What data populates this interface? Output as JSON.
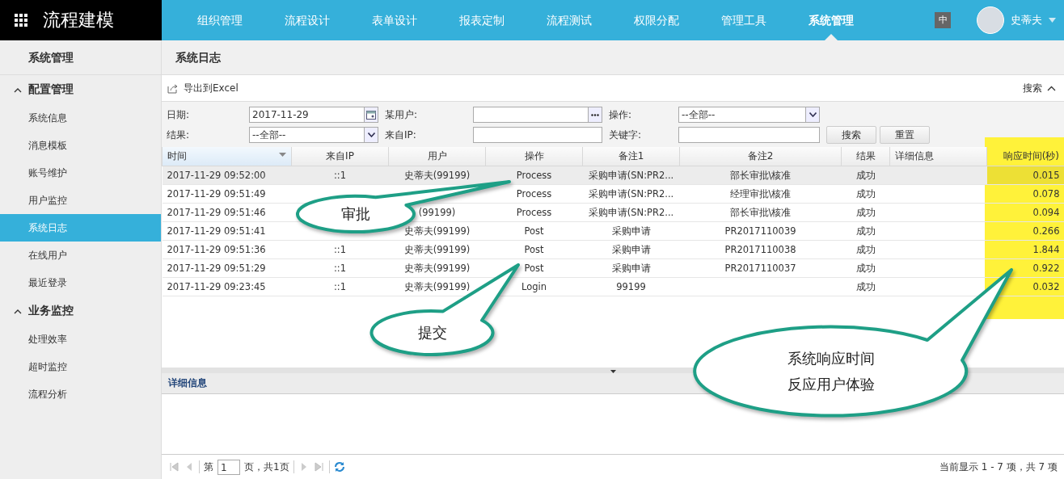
{
  "app": {
    "title": "流程建模"
  },
  "nav": [
    {
      "label": "组织管理",
      "selected": false
    },
    {
      "label": "流程设计",
      "selected": false
    },
    {
      "label": "表单设计",
      "selected": false
    },
    {
      "label": "报表定制",
      "selected": false
    },
    {
      "label": "流程测试",
      "selected": false
    },
    {
      "label": "权限分配",
      "selected": false
    },
    {
      "label": "管理工具",
      "selected": false
    },
    {
      "label": "系统管理",
      "selected": true
    }
  ],
  "language": "中",
  "user": {
    "name": "史蒂夫"
  },
  "sidebar": {
    "title": "系统管理",
    "groups": [
      {
        "label": "配置管理",
        "expanded": true,
        "children": [
          {
            "label": "系统信息",
            "selected": false
          },
          {
            "label": "消息模板",
            "selected": false
          },
          {
            "label": "账号维护",
            "selected": false
          },
          {
            "label": "用户监控",
            "selected": false
          },
          {
            "label": "系统日志",
            "selected": true
          },
          {
            "label": "在线用户",
            "selected": false
          },
          {
            "label": "最近登录",
            "selected": false
          }
        ]
      },
      {
        "label": "业务监控",
        "expanded": true,
        "children": [
          {
            "label": "处理效率",
            "selected": false
          },
          {
            "label": "超时监控",
            "selected": false
          },
          {
            "label": "流程分析",
            "selected": false
          }
        ]
      }
    ]
  },
  "page": {
    "title": "系统日志"
  },
  "toolbar": {
    "export": "导出到Excel",
    "search_toggle": "搜索"
  },
  "filters": [
    {
      "label": "日期:",
      "kind": "date",
      "value": "2017-11-29"
    },
    {
      "label": "某用户:",
      "kind": "picker"
    },
    {
      "label": "操作:",
      "kind": "select",
      "value": "--全部--"
    },
    {
      "label": "结果:",
      "kind": "select",
      "value": "--全部--"
    },
    {
      "label": "来自IP:",
      "kind": "text"
    },
    {
      "label": "关键字:",
      "kind": "text"
    }
  ],
  "buttons": [
    "搜索",
    "重置"
  ],
  "table": {
    "columns": [
      {
        "label": "时间",
        "sorted": true
      },
      {
        "label": "来自IP",
        "sorted": false
      },
      {
        "label": "用户",
        "sorted": false
      },
      {
        "label": "操作",
        "sorted": false
      },
      {
        "label": "备注1",
        "sorted": false
      },
      {
        "label": "备注2",
        "sorted": false
      },
      {
        "label": "结果",
        "sorted": false
      },
      {
        "label": "详细信息",
        "sorted": false
      },
      {
        "label": "响应时间(秒)",
        "sorted": false
      }
    ],
    "rows": [
      {
        "selected": true,
        "cells": [
          "2017-11-29 09:52:00",
          "::1",
          "史蒂夫(99199)",
          "Process",
          "采购申请(SN:PR2...",
          "部长审批\\核准",
          "成功",
          "",
          "0.015"
        ]
      },
      {
        "selected": false,
        "cells": [
          "2017-11-29 09:51:49",
          "",
          "",
          "Process",
          "采购申请(SN:PR2...",
          "经理审批\\核准",
          "成功",
          "",
          "0.078"
        ]
      },
      {
        "selected": false,
        "cells": [
          "2017-11-29 09:51:46",
          "",
          "(99199)",
          "Process",
          "采购申请(SN:PR2...",
          "部长审批\\核准",
          "成功",
          "",
          "0.094"
        ]
      },
      {
        "selected": false,
        "cells": [
          "2017-11-29 09:51:41",
          "",
          "史蒂夫(99199)",
          "Post",
          "采购申请",
          "PR2017110039",
          "成功",
          "",
          "0.266"
        ]
      },
      {
        "selected": false,
        "cells": [
          "2017-11-29 09:51:36",
          "::1",
          "史蒂夫(99199)",
          "Post",
          "采购申请",
          "PR2017110038",
          "成功",
          "",
          "1.844"
        ]
      },
      {
        "selected": false,
        "cells": [
          "2017-11-29 09:51:29",
          "::1",
          "史蒂夫(99199)",
          "Post",
          "采购申请",
          "PR2017110037",
          "成功",
          "",
          "0.922"
        ]
      },
      {
        "selected": false,
        "cells": [
          "2017-11-29 09:23:45",
          "::1",
          "史蒂夫(99199)",
          "Login",
          "99199",
          "",
          "成功",
          "",
          "0.032"
        ]
      }
    ]
  },
  "detail": {
    "title": "详细信息"
  },
  "pager": {
    "prefix": "第",
    "page": "1",
    "suffix": "页，共1页",
    "summary": "当前显示 1 - 7 项，共 7 项"
  },
  "callouts": [
    {
      "lines": [
        "审批"
      ]
    },
    {
      "lines": [
        "提交"
      ]
    },
    {
      "lines": [
        "系统响应时间",
        "反应用户体验"
      ]
    }
  ]
}
